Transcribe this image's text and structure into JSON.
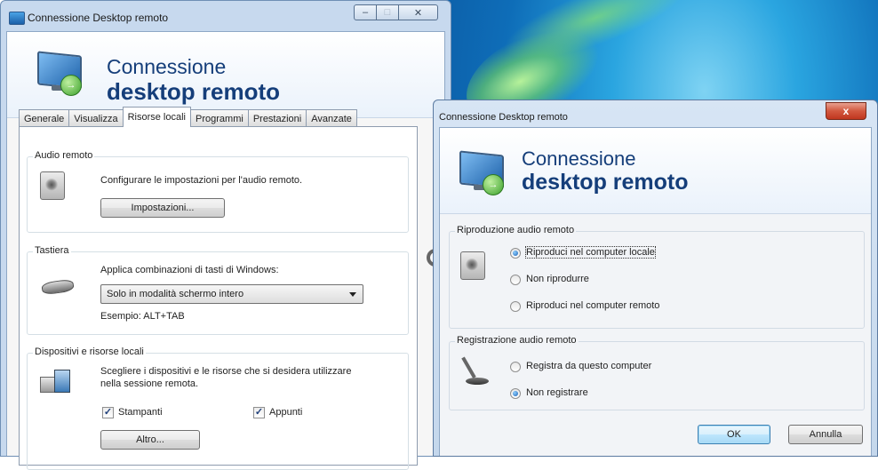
{
  "window_main": {
    "title": "Connessione Desktop remoto",
    "caption": {
      "minimize": "–",
      "maximize": "□",
      "close": "✕"
    },
    "banner": {
      "line1": "Connessione",
      "line2": "desktop remoto",
      "badge": "→"
    },
    "tabs": [
      "Generale",
      "Visualizza",
      "Risorse locali",
      "Programmi",
      "Prestazioni",
      "Avanzate"
    ],
    "active_tab": "Risorse locali",
    "audio": {
      "group_title": "Audio remoto",
      "description": "Configurare le impostazioni per l'audio remoto.",
      "button": "Impostazioni..."
    },
    "keyboard": {
      "group_title": "Tastiera",
      "description": "Applica combinazioni di tasti di Windows:",
      "combo_value": "Solo in modalità schermo intero",
      "example": "Esempio: ALT+TAB"
    },
    "devices": {
      "group_title": "Dispositivi e risorse locali",
      "description_line1": "Scegliere i dispositivi e le risorse che si desidera utilizzare",
      "description_line2": "nella sessione remota.",
      "check_printers": "Stampanti",
      "check_clipboard": "Appunti",
      "check_mark": "✓",
      "button": "Altro..."
    }
  },
  "window_audio": {
    "title": "Connessione Desktop remoto",
    "close": "x",
    "banner": {
      "line1": "Connessione",
      "line2": "desktop remoto",
      "badge": "→"
    },
    "playback": {
      "group_title": "Riproduzione audio remoto",
      "options": [
        "Riproduci nel computer locale",
        "Non riprodurre",
        "Riproduci nel computer remoto"
      ],
      "selected_index": 0
    },
    "recording": {
      "group_title": "Registrazione audio remoto",
      "options": [
        "Registra da questo computer",
        "Non registrare"
      ],
      "selected_index": 1
    },
    "ok": "OK",
    "cancel": "Annulla"
  }
}
